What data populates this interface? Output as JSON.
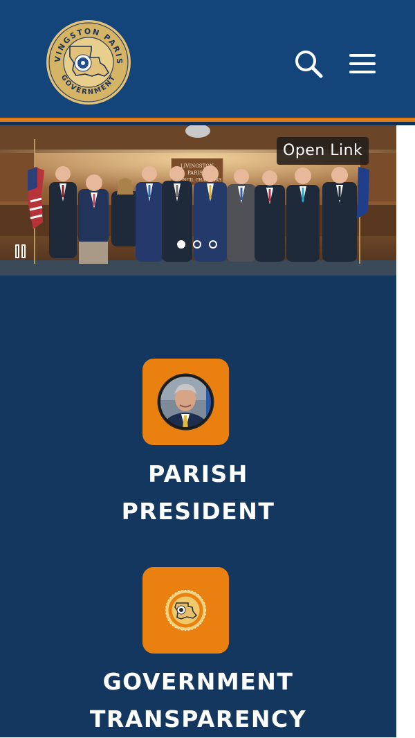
{
  "header": {
    "logo": {
      "arc_top": "LIVINGSTON PARISH",
      "arc_bottom": "GOVERNMENT",
      "seal_text": "LIVINGSTON PARISH"
    },
    "icons": {
      "search": "search-icon",
      "menu": "hamburger-menu-icon"
    },
    "colors": {
      "background": "#14457a",
      "accent": "#e07b14"
    }
  },
  "hero": {
    "open_link_label": "Open Link",
    "slides_total": 3,
    "active_slide": 1,
    "wall_sign": [
      "LIVINGSTON",
      "PARISH",
      "COUNCIL CHAMBERS"
    ]
  },
  "main": {
    "colors": {
      "background": "#14375f",
      "tile": "#e9800f"
    },
    "tiles": [
      {
        "label_lines": [
          "PARISH",
          "PRESIDENT"
        ]
      },
      {
        "label_lines": [
          "GOVERNMENT",
          "TRANSPARENCY"
        ]
      }
    ]
  }
}
